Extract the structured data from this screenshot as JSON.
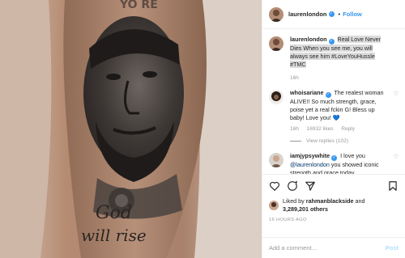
{
  "header": {
    "username": "laurenlondon",
    "separator": "•",
    "follow_label": "Follow"
  },
  "caption": {
    "username": "laurenlondon",
    "text": "Real Love Never Dies When you see me, you will always see him #LoveYouHussle #TMC",
    "time": "16h"
  },
  "comments": [
    {
      "username": "whoisariane",
      "text": "The realest woman ALIVE!! So much strength, grace, poise yet a real fckin G! Bless up baby! Love you!",
      "emoji": "💙",
      "time": "16h",
      "likes": "16932 likes",
      "reply_label": "Reply",
      "view_replies": "View replies (102)"
    },
    {
      "username": "iamjypsywhite",
      "text_before": "I love you ",
      "mention": "@laurenlondon",
      "text_after": " you showed iconic strength and grace today"
    }
  ],
  "actions": {
    "icons": [
      "heart-icon",
      "comment-icon",
      "share-icon",
      "bookmark-icon"
    ]
  },
  "likes": {
    "prefix": "Liked by",
    "user": "rahmanblackside",
    "conj": "and",
    "count": "3,289,201 others"
  },
  "timestamp": "16 HOURS AGO",
  "add_comment": {
    "placeholder": "Add a comment…",
    "post_label": "Post"
  },
  "photo": {
    "tattoo_text_top": "YO RE",
    "tattoo_text_1": "God",
    "tattoo_text_2": "will rise"
  },
  "colors": {
    "accent": "#3897f0",
    "muted": "#999999",
    "skin": "#b7917a"
  }
}
